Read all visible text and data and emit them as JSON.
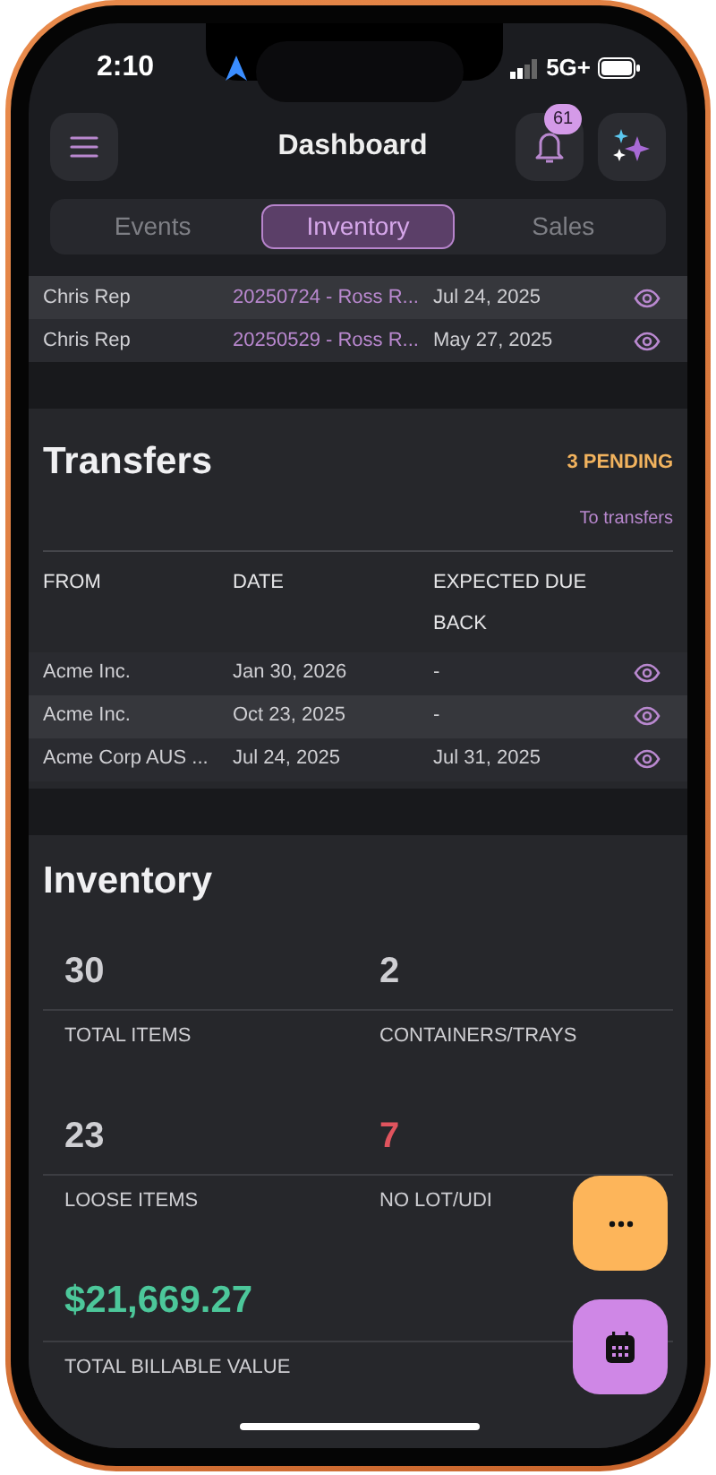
{
  "status_bar": {
    "time": "2:10",
    "network": "5G+"
  },
  "header": {
    "title": "Dashboard",
    "notification_count": "61"
  },
  "tabs": [
    {
      "label": "Events",
      "selected": false
    },
    {
      "label": "Inventory",
      "selected": true
    },
    {
      "label": "Sales",
      "selected": false
    }
  ],
  "recent_rows": [
    {
      "rep": "Chris Rep",
      "event": "20250724 - Ross R...",
      "date": "Jul 24, 2025",
      "highlighted": true
    },
    {
      "rep": "Chris Rep",
      "event": "20250529 - Ross R...",
      "date": "May 27, 2025",
      "highlighted": false
    }
  ],
  "transfers": {
    "title": "Transfers",
    "pending": "3 PENDING",
    "link": "To transfers",
    "columns": [
      "FROM",
      "DATE",
      "EXPECTED DUE BACK"
    ],
    "rows": [
      {
        "from": "Acme Inc.",
        "date": "Jan 30, 2026",
        "due": "-",
        "highlighted": false
      },
      {
        "from": "Acme Inc.",
        "date": "Oct 23, 2025",
        "due": "-",
        "highlighted": true
      },
      {
        "from": "Acme Corp AUS ...",
        "date": "Jul 24, 2025",
        "due": "Jul 31, 2025",
        "highlighted": false
      }
    ]
  },
  "inventory": {
    "title": "Inventory",
    "stats": [
      {
        "value": "30",
        "label": "TOTAL ITEMS",
        "color": "#cfcfd3"
      },
      {
        "value": "2",
        "label": "CONTAINERS/TRAYS",
        "color": "#cfcfd3"
      },
      {
        "value": "23",
        "label": "LOOSE ITEMS",
        "color": "#cfcfd3"
      },
      {
        "value": "7",
        "label": "NO LOT/UDI",
        "color": "#e0545e"
      }
    ],
    "total": {
      "value": "$21,669.27",
      "label": "TOTAL BILLABLE VALUE",
      "color": "#4cc79a"
    }
  }
}
